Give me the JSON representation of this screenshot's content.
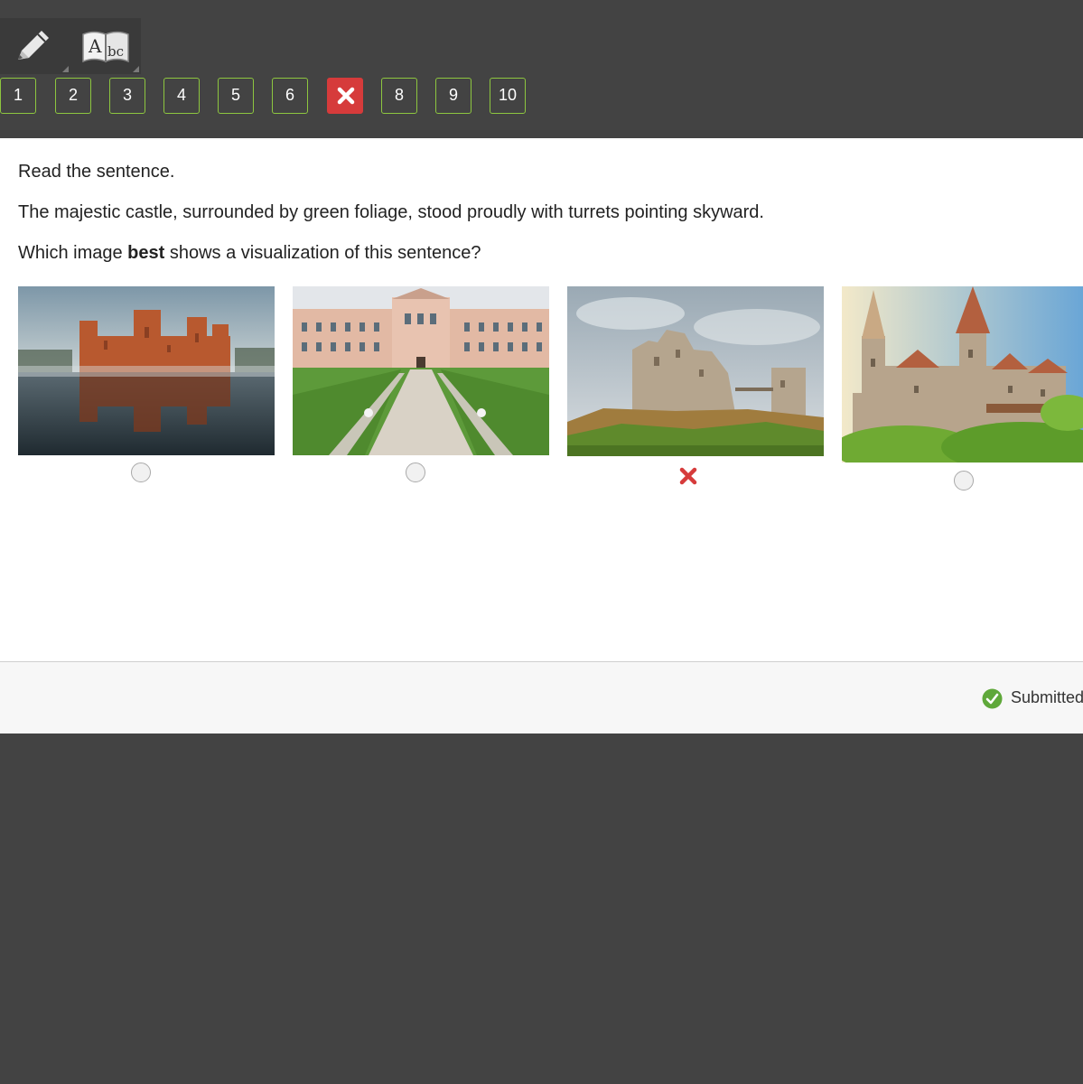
{
  "toolbar": {
    "tools": [
      {
        "name": "pencil-icon"
      },
      {
        "name": "dictionary-icon",
        "glyph": "A|bc"
      }
    ]
  },
  "question_nav": {
    "items": [
      {
        "label": "1",
        "state": "default"
      },
      {
        "label": "2",
        "state": "default"
      },
      {
        "label": "3",
        "state": "default"
      },
      {
        "label": "4",
        "state": "default"
      },
      {
        "label": "5",
        "state": "default"
      },
      {
        "label": "6",
        "state": "default"
      },
      {
        "label": "",
        "state": "incorrect",
        "icon": "x-icon"
      },
      {
        "label": "8",
        "state": "default"
      },
      {
        "label": "9",
        "state": "default"
      },
      {
        "label": "10",
        "state": "default"
      }
    ]
  },
  "question": {
    "instruction": "Read the sentence.",
    "sentence": "The majestic castle, surrounded by green foliage, stood proudly with turrets pointing skyward.",
    "prompt_before": "Which image ",
    "prompt_bold": "best",
    "prompt_after": " shows a visualization of this sentence?"
  },
  "choices": [
    {
      "image": "castle-on-lake-image",
      "state": "unselected"
    },
    {
      "image": "palace-garden-image",
      "state": "unselected"
    },
    {
      "image": "castle-ruins-image",
      "state": "incorrect"
    },
    {
      "image": "castle-with-turrets-image",
      "state": "unselected"
    }
  ],
  "footer": {
    "status": "Submitted"
  },
  "colors": {
    "accent_green": "#8dc63f",
    "incorrect_red": "#d63b3b",
    "success_green": "#5fa83a"
  }
}
